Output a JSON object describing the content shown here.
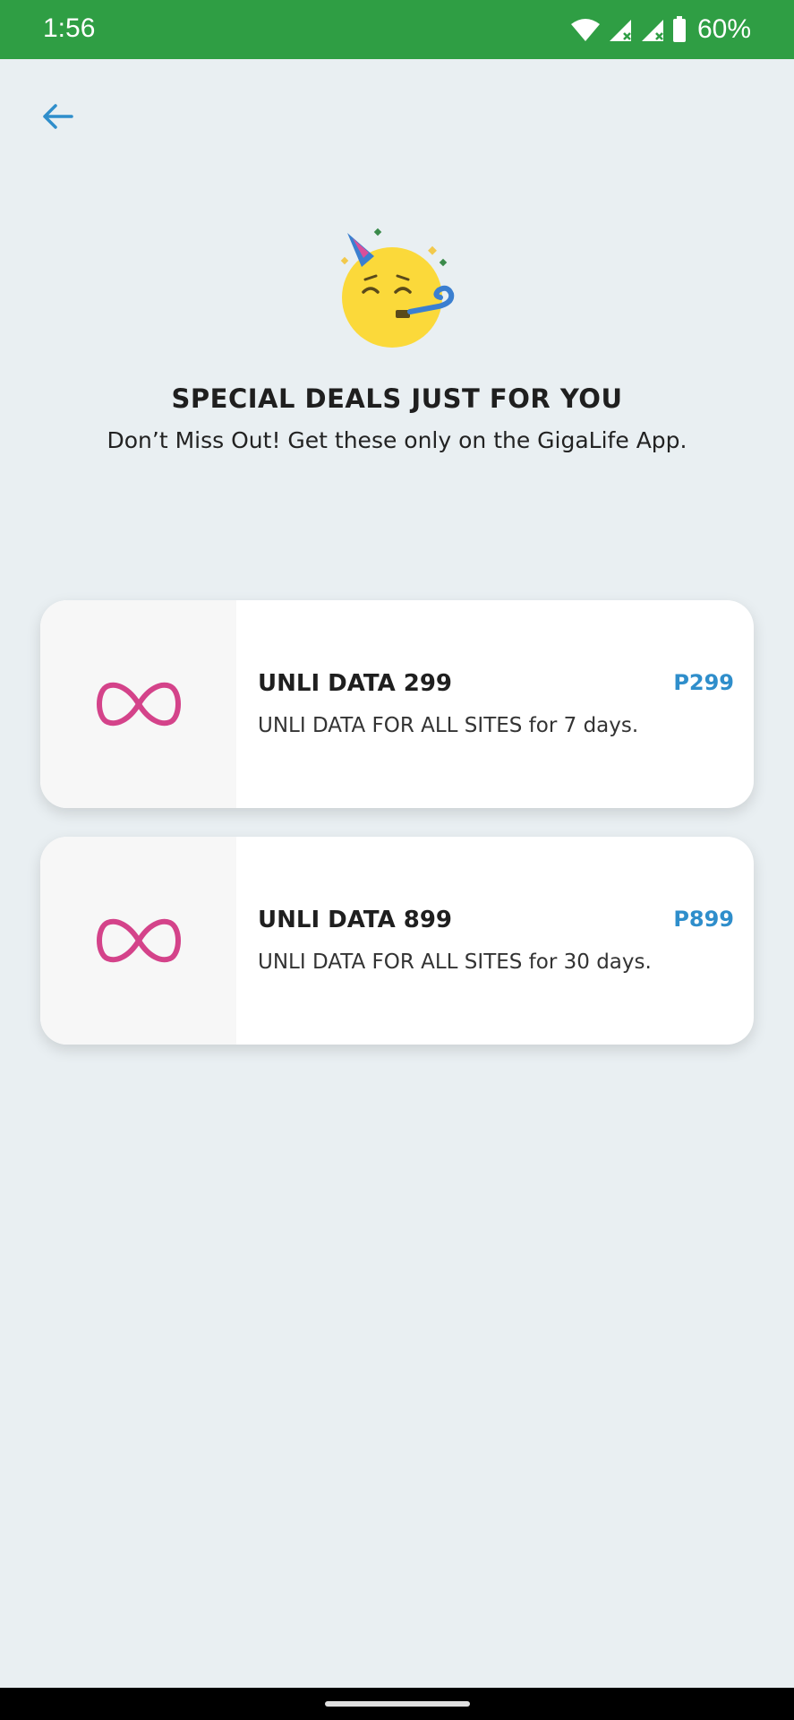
{
  "status_bar": {
    "time": "1:56",
    "battery": "60%",
    "icons": [
      "wifi-icon",
      "signal-icon",
      "signal-icon",
      "battery-icon"
    ]
  },
  "header": {
    "back_icon": "arrow-left-icon"
  },
  "hero": {
    "emoji": "party-face-icon",
    "title": "SPECIAL DEALS JUST FOR YOU",
    "subtitle": "Don’t Miss Out! Get these only on the GigaLife App."
  },
  "deals": [
    {
      "icon": "infinity-icon",
      "name": "UNLI DATA 299",
      "description": "UNLI DATA FOR ALL SITES for 7 days.",
      "price": "P299"
    },
    {
      "icon": "infinity-icon",
      "name": "UNLI DATA 899",
      "description": "UNLI DATA FOR ALL SITES for 30 days.",
      "price": "P899"
    }
  ],
  "colors": {
    "status_bar": "#2f9e44",
    "background": "#e9eff2",
    "accent_blue": "#2f8ecb",
    "infinity_pink": "#d4438a",
    "emoji_yellow": "#fbd93a"
  }
}
